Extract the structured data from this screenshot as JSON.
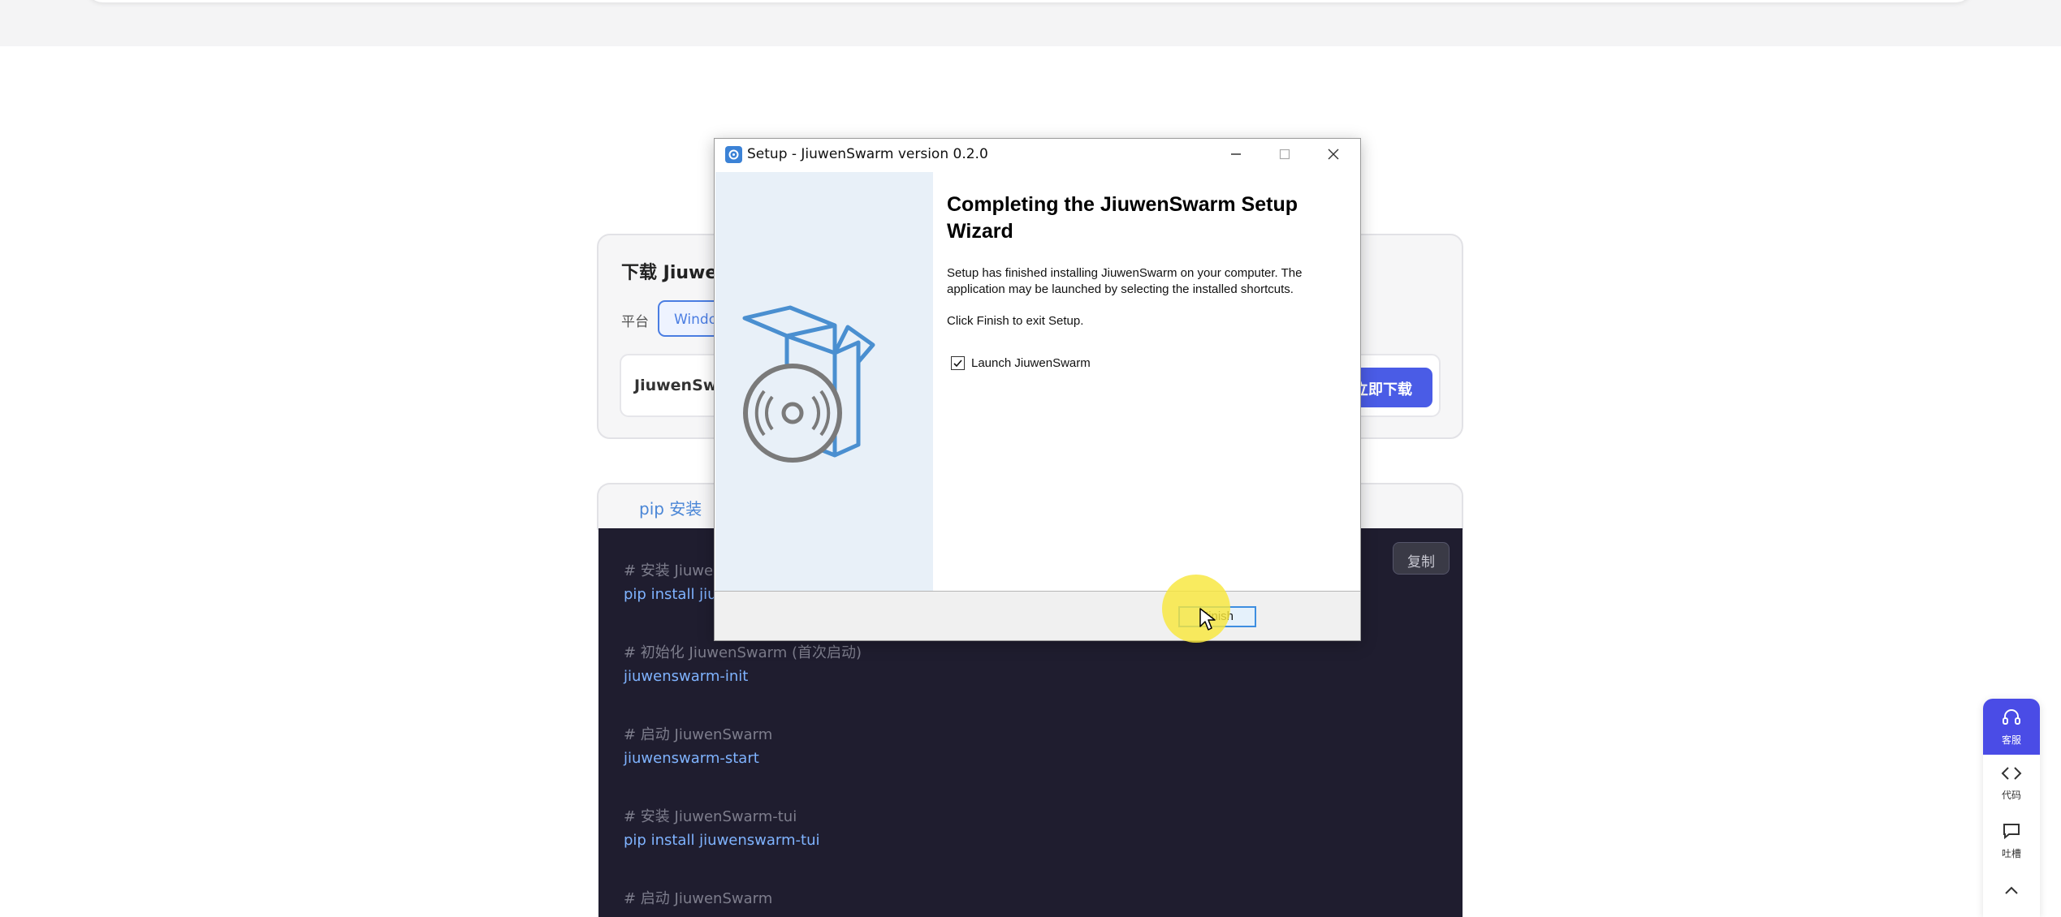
{
  "page": {
    "download": {
      "title": "下载 Jiuwen",
      "platform_label": "平台",
      "platform_selected": "Windows",
      "item_name": "JiuwenSwarm",
      "download_button": "立即下载"
    },
    "tabs": [
      {
        "label": "pip 安装"
      }
    ],
    "code": {
      "copy_label": "复制",
      "lines": [
        {
          "kind": "comment",
          "text": "# 安装 JiuwenSwarm"
        },
        {
          "kind": "cmd",
          "text": "pip install jiuwenswarm"
        },
        {
          "kind": "comment",
          "text": "# 初始化 JiuwenSwarm (首次启动)"
        },
        {
          "kind": "cmd",
          "text": "jiuwenswarm-init"
        },
        {
          "kind": "comment",
          "text": "# 启动 JiuwenSwarm"
        },
        {
          "kind": "cmd",
          "text": "jiuwenswarm-start"
        },
        {
          "kind": "comment",
          "text": "# 安装 JiuwenSwarm-tui"
        },
        {
          "kind": "cmd",
          "text": "pip install jiuwenswarm-tui"
        },
        {
          "kind": "comment",
          "text": "# 启动 JiuwenSwarm"
        }
      ]
    },
    "float_bar": {
      "service": "客服",
      "code": "代码",
      "feedback": "吐槽"
    }
  },
  "dialog": {
    "title": "Setup - JiuwenSwarm version 0.2.0",
    "heading": "Completing the JiuwenSwarm Setup Wizard",
    "body": "Setup has finished installing JiuwenSwarm on your computer. The application may be launched by selecting the installed shortcuts.",
    "finish_hint": "Click Finish to exit Setup.",
    "launch_checkbox_label": "Launch JiuwenSwarm",
    "launch_checked": true,
    "finish_button": "Finish"
  },
  "icons": {
    "service": "headset-icon",
    "code": "code-brackets-icon",
    "feedback": "chat-bubble-icon",
    "scroll_top": "chevron-up-icon",
    "wizard": "box-disc-icon"
  },
  "colors": {
    "accent": "#4a5ce6",
    "link": "#4a86d6",
    "code_bg": "#1f1d2f",
    "wizard_side": "#e8f0f8"
  }
}
